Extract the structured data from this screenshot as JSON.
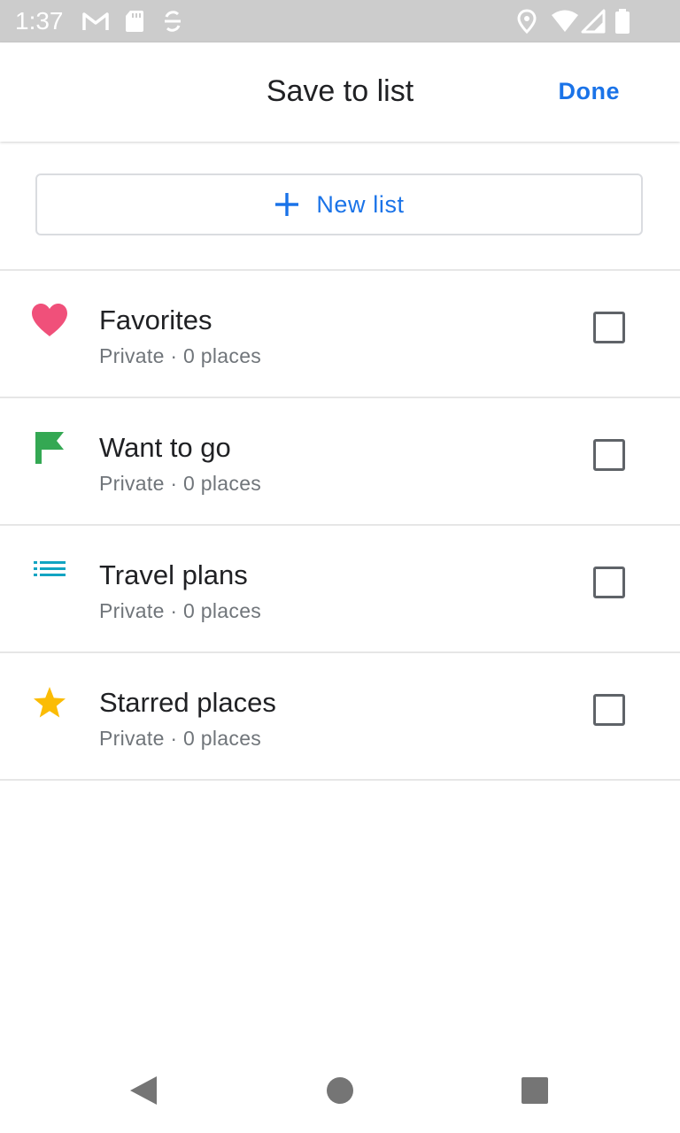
{
  "status_bar": {
    "time": "1:37",
    "icons": [
      "gmail-icon",
      "sd-card-icon",
      "sync-icon",
      "location-icon",
      "wifi-icon",
      "cell-signal-icon",
      "battery-icon"
    ]
  },
  "header": {
    "title": "Save to list",
    "done_label": "Done"
  },
  "new_list": {
    "label": "New list",
    "icon": "plus-icon"
  },
  "lists": [
    {
      "title": "Favorites",
      "subtitle": "Private · 0 places",
      "icon": "heart-icon",
      "icon_color": "#f0507a",
      "checked": false
    },
    {
      "title": "Want to go",
      "subtitle": "Private · 0 places",
      "icon": "flag-icon",
      "icon_color": "#34a853",
      "checked": false
    },
    {
      "title": "Travel plans",
      "subtitle": "Private · 0 places",
      "icon": "list-icon",
      "icon_color": "#12a4c2",
      "checked": false
    },
    {
      "title": "Starred places",
      "subtitle": "Private · 0 places",
      "icon": "star-icon",
      "icon_color": "#fbbc04",
      "checked": false
    }
  ],
  "nav_bar": {
    "buttons": [
      "back-icon",
      "home-icon",
      "recents-icon"
    ]
  },
  "colors": {
    "accent": "#1a73e8",
    "status_bar": "#cccccc",
    "divider": "#e6e6e6"
  }
}
